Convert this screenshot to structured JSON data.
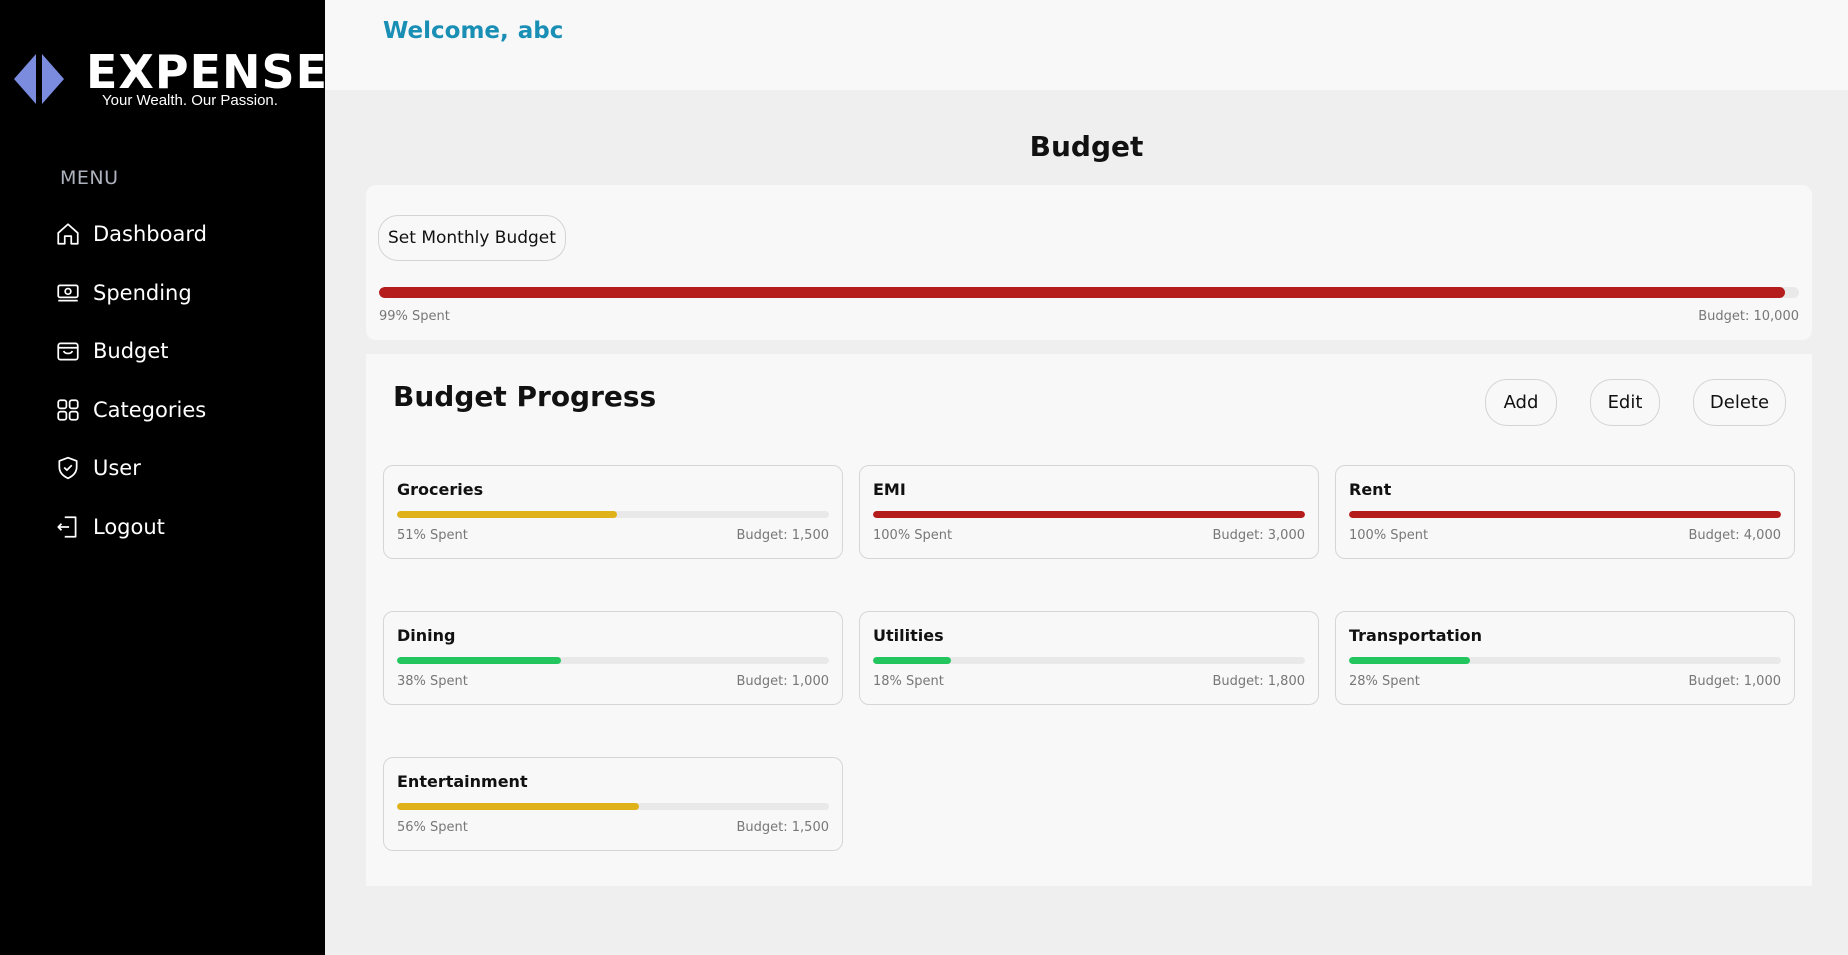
{
  "brand": {
    "name": "EXPENSE",
    "tagline": "Your Wealth. Our Passion.",
    "mark_color": "#7b8cde"
  },
  "sidebar": {
    "menu_label": "MENU",
    "items": [
      {
        "label": "Dashboard",
        "icon": "home-icon"
      },
      {
        "label": "Spending",
        "icon": "money-icon"
      },
      {
        "label": "Budget",
        "icon": "wallet-icon"
      },
      {
        "label": "Categories",
        "icon": "grid-icon"
      },
      {
        "label": "User",
        "icon": "shield-check-icon"
      },
      {
        "label": "Logout",
        "icon": "logout-icon"
      }
    ]
  },
  "header": {
    "welcome": "Welcome,",
    "username": "abc",
    "accent_color": "#1a8fb5"
  },
  "page": {
    "title": "Budget"
  },
  "monthly_budget": {
    "button_label": "Set Monthly Budget",
    "spent_text": "99% Spent",
    "budget_text": "Budget: 10,000",
    "percent": 99,
    "color": "#b51d1d"
  },
  "progress": {
    "title": "Budget Progress",
    "add_label": "Add",
    "edit_label": "Edit",
    "delete_label": "Delete",
    "categories": [
      {
        "name": "Groceries",
        "spent_text": "51% Spent",
        "budget_text": "Budget: 1,500",
        "percent": 51,
        "color": "#e0b21a"
      },
      {
        "name": "EMI",
        "spent_text": "100% Spent",
        "budget_text": "Budget: 3,000",
        "percent": 100,
        "color": "#b51d1d"
      },
      {
        "name": "Rent",
        "spent_text": "100% Spent",
        "budget_text": "Budget: 4,000",
        "percent": 100,
        "color": "#b51d1d"
      },
      {
        "name": "Dining",
        "spent_text": "38% Spent",
        "budget_text": "Budget: 1,000",
        "percent": 38,
        "color": "#22c55e"
      },
      {
        "name": "Utilities",
        "spent_text": "18% Spent",
        "budget_text": "Budget: 1,800",
        "percent": 18,
        "color": "#22c55e"
      },
      {
        "name": "Transportation",
        "spent_text": "28% Spent",
        "budget_text": "Budget: 1,000",
        "percent": 28,
        "color": "#22c55e"
      },
      {
        "name": "Entertainment",
        "spent_text": "56% Spent",
        "budget_text": "Budget: 1,500",
        "percent": 56,
        "color": "#e0b21a"
      }
    ]
  }
}
